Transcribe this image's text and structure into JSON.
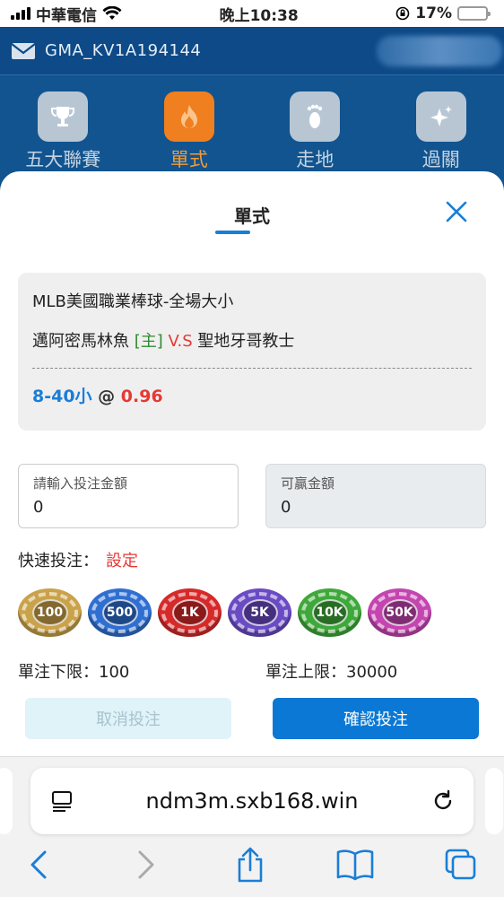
{
  "status_bar": {
    "carrier": "中華電信",
    "time": "晚上10:38",
    "battery": "17%",
    "battery_level": 0.17
  },
  "header": {
    "account": "GMA_KV1A194144"
  },
  "nav": [
    {
      "label": "五大聯賽",
      "icon": "trophy-icon"
    },
    {
      "label": "單式",
      "icon": "flame-icon"
    },
    {
      "label": "走地",
      "icon": "footprint-icon"
    },
    {
      "label": "過關",
      "icon": "sparkle-icon"
    }
  ],
  "modal": {
    "title": "單式",
    "bet": {
      "league": "MLB美國職業棒球-全場大小",
      "home_team": "邁阿密馬林魚",
      "home_tag": "[主]",
      "vs": "V.S",
      "away_team": "聖地牙哥教士",
      "selection": "8-40小",
      "at": "@",
      "odds": "0.96"
    },
    "stake": {
      "label": "請輸入投注金額",
      "value": "0"
    },
    "win": {
      "label": "可贏金額",
      "value": "0"
    },
    "quick_bet": {
      "label": "快速投注：",
      "setting": "設定"
    },
    "chips": [
      {
        "label": "100",
        "color": "#c9a24a"
      },
      {
        "label": "500",
        "color": "#2f6fd1"
      },
      {
        "label": "1K",
        "color": "#d62a2a"
      },
      {
        "label": "5K",
        "color": "#6a4bc4"
      },
      {
        "label": "10K",
        "color": "#3fa83a"
      },
      {
        "label": "50K",
        "color": "#c445b0"
      }
    ],
    "min_limit": "單注下限：100",
    "max_limit": "單注上限：30000",
    "cancel_label": "取消投注",
    "confirm_label": "確認投注"
  },
  "browser": {
    "url": "ndm3m.sxb168.win"
  }
}
